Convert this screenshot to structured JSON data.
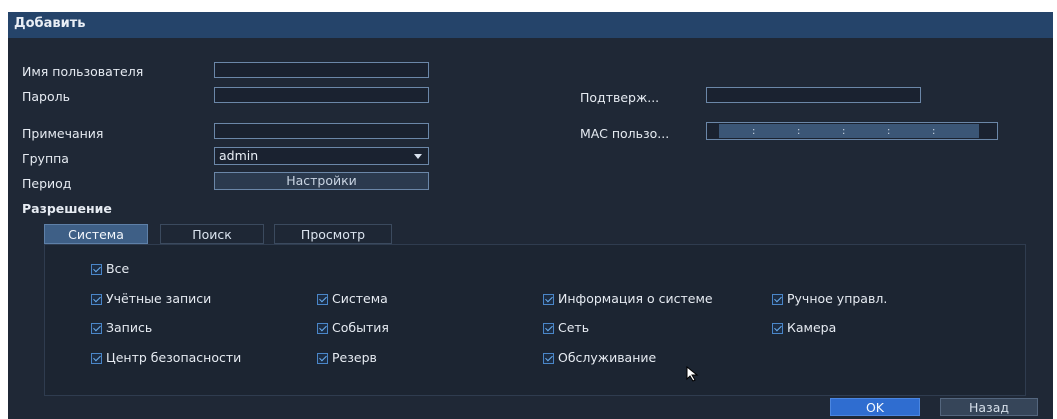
{
  "window": {
    "title": "Добавить"
  },
  "form": {
    "username_label": "Имя пользователя",
    "password_label": "Пароль",
    "confirm_label": "Подтверж...",
    "notes_label": "Примечания",
    "mac_label": "MAC пользо...",
    "group_label": "Группа",
    "group_value": "admin",
    "period_label": "Период",
    "period_button": "Настройки",
    "permission_label": "Разрешение"
  },
  "tabs": [
    {
      "label": "Система",
      "active": true
    },
    {
      "label": "Поиск",
      "active": false
    },
    {
      "label": "Просмотр",
      "active": false
    }
  ],
  "permissions": {
    "all": "Все",
    "items": [
      "Учётные записи",
      "Система",
      "Информация о системе",
      "Ручное управл.",
      "Запись",
      "События",
      "Сеть",
      "Камера",
      "Центр безопасности",
      "Резерв",
      "Обслуживание"
    ]
  },
  "buttons": {
    "ok": "OK",
    "back": "Назад"
  },
  "colors": {
    "accent": "#2f6dd0",
    "titlebar": "#25446a",
    "background": "#1f2836"
  }
}
